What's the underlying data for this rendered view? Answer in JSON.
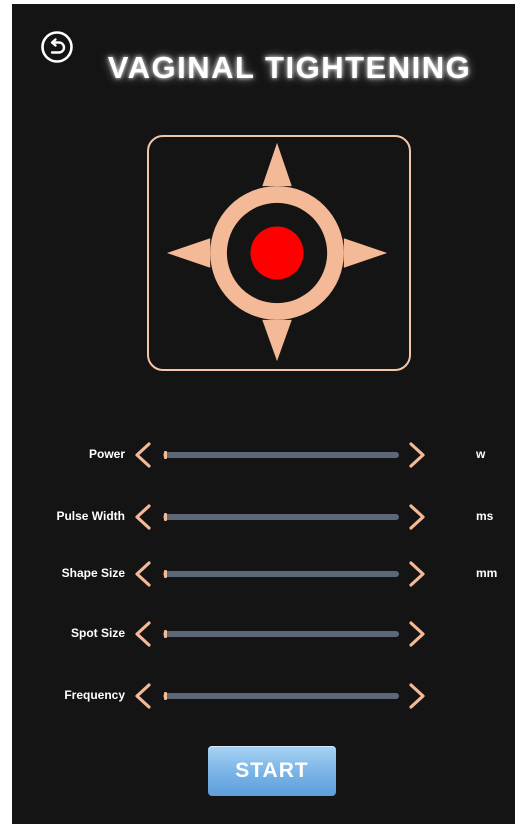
{
  "header": {
    "back_icon": "back-return-icon",
    "title": "VAGINAL TIGHTENING"
  },
  "target": {
    "icon": "crosshair-target-icon",
    "ring_color": "#f4b996",
    "dot_color": "#ff0000",
    "frame_color": "#f2c7a8"
  },
  "params": [
    {
      "label": "Power",
      "unit": "w",
      "level": 0
    },
    {
      "label": "Pulse Width",
      "unit": "ms",
      "level": 0
    },
    {
      "label": "Shape Size",
      "unit": "mm",
      "level": 0
    },
    {
      "label": "Spot Size",
      "unit": "",
      "level": 0
    },
    {
      "label": "Frequency",
      "unit": "",
      "level": 0
    }
  ],
  "actions": {
    "start_label": "START"
  },
  "colors": {
    "background": "#141414",
    "accent": "#f4b996",
    "track": "#5c6878",
    "button": "#7fb8e8"
  }
}
